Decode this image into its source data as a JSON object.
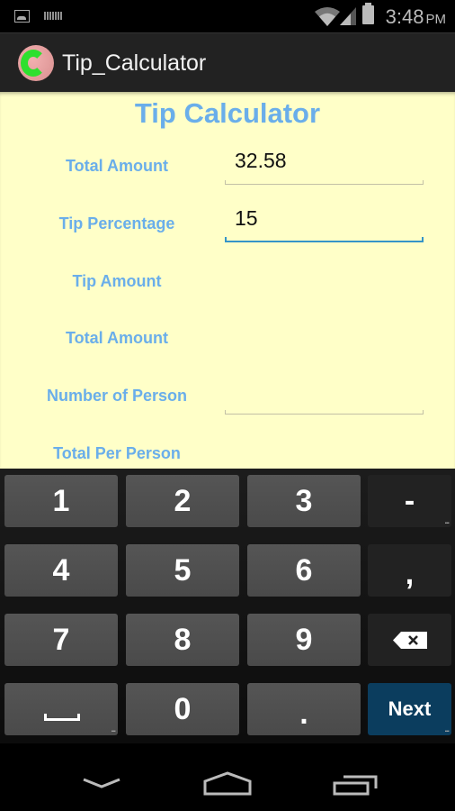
{
  "status_bar": {
    "icons": [
      "gallery-notification-icon",
      "keyboard-notification-icon",
      "wifi-icon",
      "signal-icon",
      "battery-icon"
    ],
    "time": "3:48",
    "ampm": "PM"
  },
  "action_bar": {
    "app_icon": "app-logo-icon",
    "title": "Tip_Calculator"
  },
  "form": {
    "title": "Tip Calculator",
    "rows": [
      {
        "label": "Total Amount",
        "value": "32.58",
        "has_input": true,
        "focused": false
      },
      {
        "label": "Tip Percentage",
        "value": "15",
        "has_input": true,
        "focused": true
      },
      {
        "label": "Tip Amount",
        "value": "",
        "has_input": false
      },
      {
        "label": "Total Amount",
        "value": "",
        "has_input": false
      },
      {
        "label": "Number of Person",
        "value": "",
        "has_input": true,
        "focused": false
      },
      {
        "label": "Total Per Person",
        "value": "",
        "has_input": false
      }
    ],
    "colors": {
      "label": "#6aaeea",
      "background": "#ffffc8",
      "focus_line": "#3594c8"
    }
  },
  "keyboard": {
    "rows": [
      [
        "1",
        "2",
        "3",
        "-"
      ],
      [
        "4",
        "5",
        "6",
        ","
      ],
      [
        "7",
        "8",
        "9",
        "backspace"
      ],
      [
        "space",
        "0",
        ".",
        "Next"
      ]
    ],
    "keys": {
      "k1": "1",
      "k2": "2",
      "k3": "3",
      "minus": "-",
      "k4": "4",
      "k5": "5",
      "k6": "6",
      "comma": ",",
      "k7": "7",
      "k8": "8",
      "k9": "9",
      "k0": "0",
      "period": ".",
      "next": "Next"
    },
    "more_indicator": "...",
    "next_color": "#0b3d5e"
  },
  "nav_bar": {
    "buttons": [
      "back-icon",
      "home-icon",
      "recent-apps-icon"
    ]
  }
}
